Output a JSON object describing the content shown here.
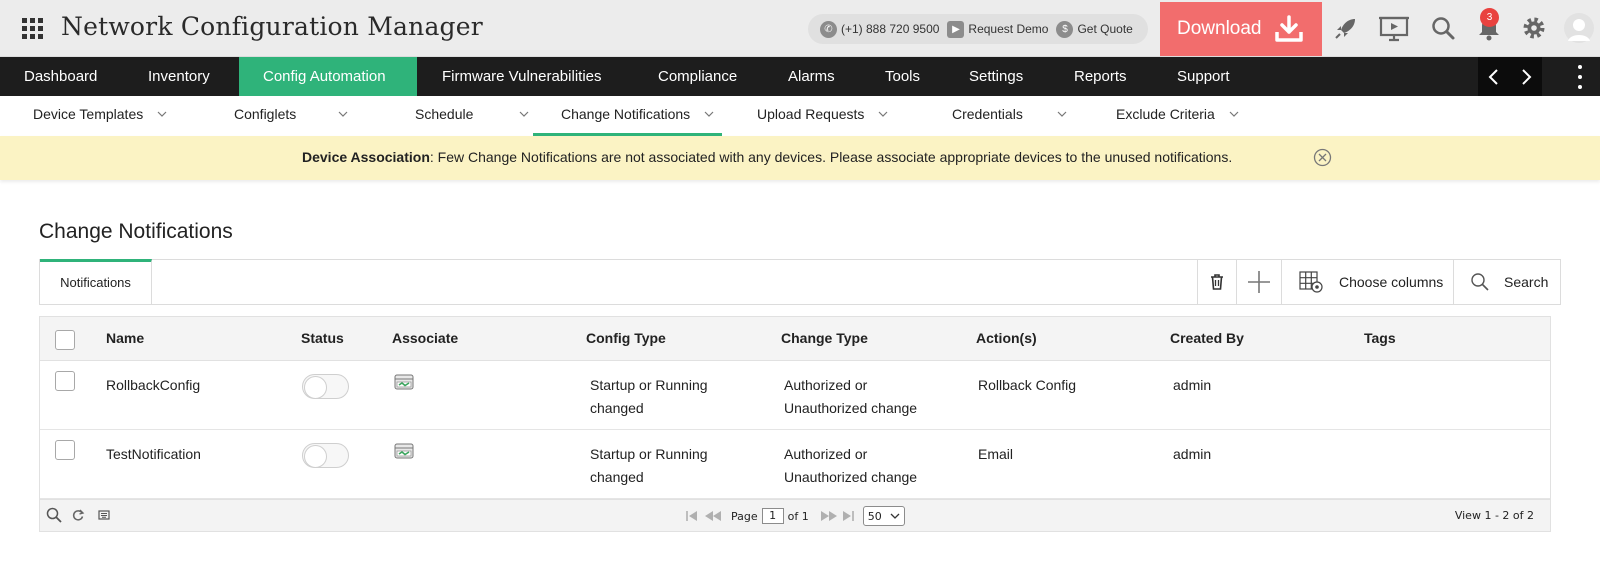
{
  "header": {
    "app_title": "Network Configuration Manager",
    "phone": "(+1) 888 720 9500",
    "request_demo": "Request Demo",
    "get_quote": "Get Quote",
    "download_label": "Download",
    "notification_count": "3",
    "colors": {
      "download_bg": "#f26d6d",
      "accent": "#2fb37a"
    }
  },
  "main_nav": {
    "items": [
      {
        "label": "Dashboard"
      },
      {
        "label": "Inventory"
      },
      {
        "label": "Config Automation",
        "active": true
      },
      {
        "label": "Firmware Vulnerabilities"
      },
      {
        "label": "Compliance"
      },
      {
        "label": "Alarms"
      },
      {
        "label": "Tools"
      },
      {
        "label": "Settings"
      },
      {
        "label": "Reports"
      },
      {
        "label": "Support"
      }
    ]
  },
  "sub_nav": {
    "items": [
      {
        "label": "Device Templates"
      },
      {
        "label": "Configlets"
      },
      {
        "label": "Schedule"
      },
      {
        "label": "Change Notifications",
        "active": true
      },
      {
        "label": "Upload Requests"
      },
      {
        "label": "Credentials"
      },
      {
        "label": "Exclude Criteria"
      }
    ]
  },
  "banner": {
    "title": "Device Association",
    "message": ": Few Change Notifications are not associated with any devices. Please associate appropriate devices to the unused notifications."
  },
  "page": {
    "title": "Change Notifications"
  },
  "toolbar": {
    "tab_label": "Notifications",
    "choose_columns": "Choose columns",
    "search": "Search"
  },
  "table": {
    "columns": [
      "Name",
      "Status",
      "Associate",
      "Config Type",
      "Change Type",
      "Action(s)",
      "Created By",
      "Tags"
    ],
    "rows": [
      {
        "name": "RollbackConfig",
        "status_on": false,
        "config_type_1": "Startup or Running",
        "config_type_2": "changed",
        "change_type_1": "Authorized or",
        "change_type_2": "Unauthorized change",
        "action": "Rollback Config",
        "created_by": "admin",
        "tags": ""
      },
      {
        "name": "TestNotification",
        "status_on": false,
        "config_type_1": "Startup or Running",
        "config_type_2": "changed",
        "change_type_1": "Authorized or",
        "change_type_2": "Unauthorized change",
        "action": "Email",
        "created_by": "admin",
        "tags": ""
      }
    ]
  },
  "pager": {
    "page_label": "Page",
    "page_value": "1",
    "of_label": "of 1",
    "page_size": "50",
    "view_info": "View 1 - 2 of 2"
  }
}
